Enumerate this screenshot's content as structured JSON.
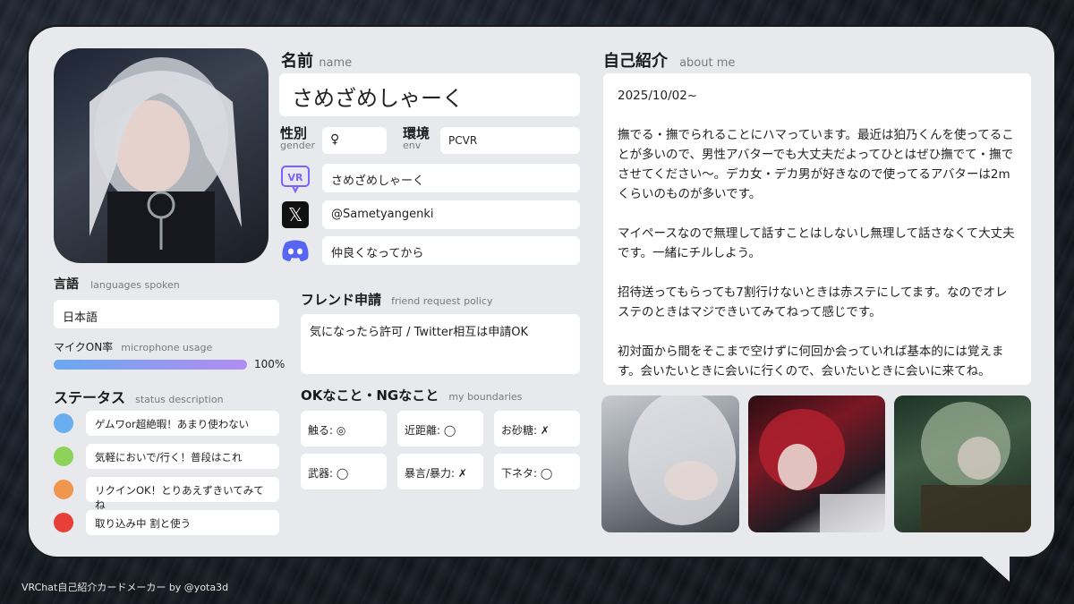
{
  "profile": {
    "name_label": "名前",
    "name_sub": "name",
    "name_value": "さめざめしゃーく",
    "gender_label": "性別",
    "gender_sub": "gender",
    "gender_value": "♀",
    "env_label": "環境",
    "env_sub": "env",
    "env_value": "PCVR",
    "vrchat_name": "さめざめしゃーく",
    "twitter_handle": "@Sametyangenki",
    "discord_policy": "仲良くなってから"
  },
  "languages": {
    "label": "言語",
    "sub": "languages spoken",
    "value": "日本語"
  },
  "mic": {
    "label": "マイクON率",
    "sub": "microphone usage",
    "value_text": "100%",
    "fraction": 1.0
  },
  "status": {
    "label": "ステータス",
    "sub": "status description",
    "items": [
      {
        "color": "#6aaef0",
        "text": "ゲムワor超絶暇！あまり使わない"
      },
      {
        "color": "#8dd35a",
        "text": "気軽においで/行く！普段はこれ"
      },
      {
        "color": "#f0964e",
        "text": "リクインOK！とりあえずきいてみてね"
      },
      {
        "color": "#e84036",
        "text": "取り込み中 割と使う"
      }
    ]
  },
  "friend": {
    "label": "フレンド申請",
    "sub": "friend request policy",
    "value": "気になったら許可 / Twitter相互は申請OK"
  },
  "boundaries": {
    "label": "OKなこと・NGなこと",
    "sub": "my boundaries",
    "items": [
      "触る: ◎",
      "近距離: ◯",
      "お砂糖: ✗",
      "武器: ◯",
      "暴言/暴力: ✗",
      "下ネタ: ◯"
    ]
  },
  "about": {
    "label": "自己紹介",
    "sub": "about me",
    "date": "2025/10/02~",
    "p1": "撫でる・撫でられることにハマっています。最近は狛乃くんを使ってることが多いので、男性アバターでも大丈夫だよってひとはぜひ撫でて・撫でさせてください〜。デカ女・デカ男が好きなので使ってるアバターは2mくらいのものが多いです。",
    "p2": "マイペースなので無理して話すことはしないし無理して話さなくて大丈夫です。一緒にチルしよう。",
    "p3": "招待送ってもらっても7割行けないときは赤ステにしてます。なのでオレステのときはマジできいてみてねって感じです。",
    "p4": "初対面から間をそこまで空けずに何回か会っていれば基本的には覚えます。会いたいときに会いに行くので、会いたいときに会いに来てね。"
  },
  "footer": "VRChat自己紹介カードメーカー by @yota3d",
  "colors": {
    "mic_bar_start": "#6aa8f0",
    "mic_bar_end": "#b28cf0",
    "vrchat_icon": "#7b61ff",
    "discord_icon": "#5865f2"
  }
}
